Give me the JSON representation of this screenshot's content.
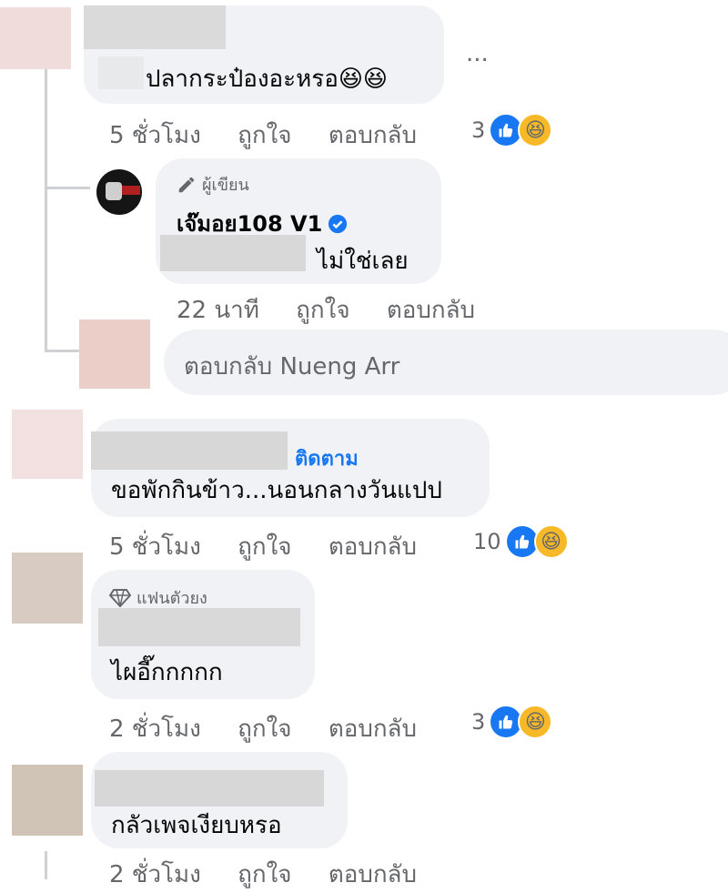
{
  "comments": [
    {
      "text": "ปลากระป๋องอะหรอ😆😆",
      "time": "5 ชั่วโมง",
      "like": "ถูกใจ",
      "reply": "ตอบกลับ",
      "reactions": "3",
      "more": "..."
    },
    {
      "badge": "ผู้เขียน",
      "author": "เจ๊มอย108 V1",
      "text": "ไม่ใช่เลย",
      "time": "22 นาที",
      "like": "ถูกใจ",
      "reply": "ตอบกลับ"
    },
    {
      "follow": "ติดตาม",
      "text": "ขอพักกินข้าว...นอนกลางวันแปป",
      "time": "5 ชั่วโมง",
      "like": "ถูกใจ",
      "reply": "ตอบกลับ",
      "reactions": "10"
    },
    {
      "badge": "แฟนตัวยง",
      "text": "ไผอี๊กกกกก",
      "time": "2 ชั่วโมง",
      "like": "ถูกใจ",
      "reply": "ตอบกลับ",
      "reactions": "3"
    },
    {
      "text": "กลัวเพจเงียบหรอ",
      "time": "2 ชั่วโมง",
      "like": "ถูกใจ",
      "reply": "ตอบกลับ"
    }
  ],
  "reply_box": {
    "placeholder": "ตอบกลับ Nueng Arr"
  },
  "colors": {
    "bubble": "#f0f2f5",
    "meta": "#65676b",
    "link": "#1877f2",
    "verified": "#1877f2"
  },
  "icons": [
    "pencil-icon",
    "verified-icon",
    "diamond-icon",
    "like-reaction-icon",
    "haha-reaction-icon",
    "more-icon"
  ]
}
